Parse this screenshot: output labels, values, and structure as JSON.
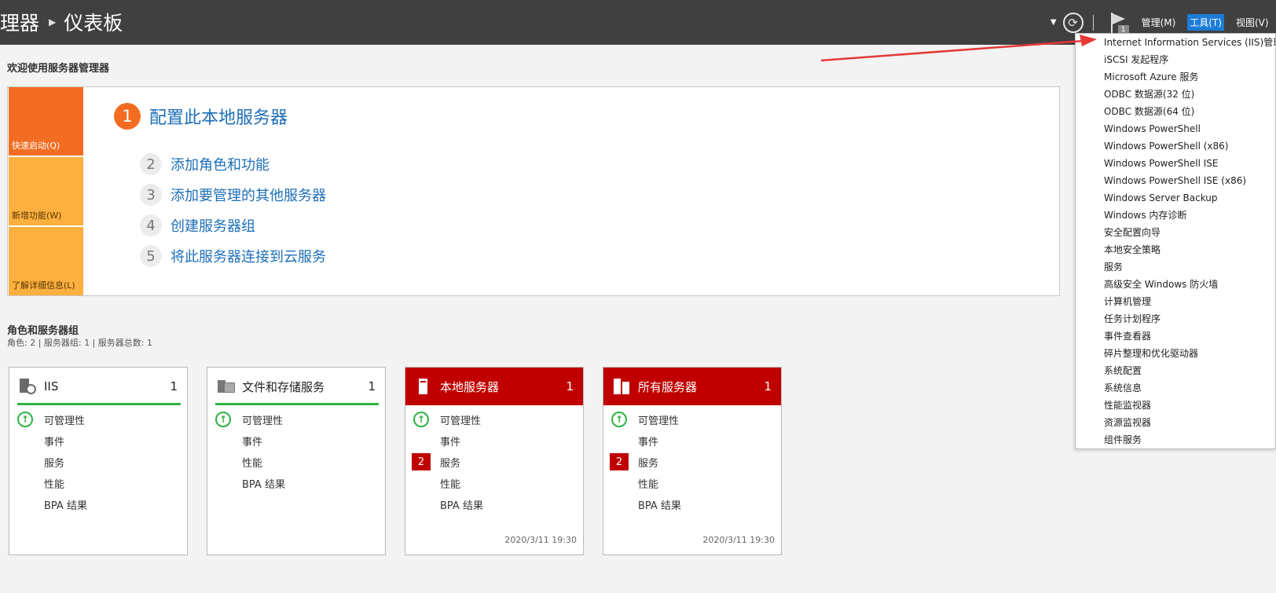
{
  "header": {
    "breadcrumb_parent": "理器",
    "breadcrumb_current": "仪表板",
    "flag_count": "1",
    "menu": {
      "manage": "管理(M)",
      "tools": "工具(T)",
      "view": "视图(V)"
    }
  },
  "welcome": {
    "title": "欢迎使用服务器管理器",
    "tiles": {
      "quick_start": "快速启动(Q)",
      "whats_new": "新增功能(W)",
      "learn_more": "了解详细信息(L)"
    },
    "steps": [
      {
        "num": "1",
        "label": "配置此本地服务器"
      },
      {
        "num": "2",
        "label": "添加角色和功能"
      },
      {
        "num": "3",
        "label": "添加要管理的其他服务器"
      },
      {
        "num": "4",
        "label": "创建服务器组"
      },
      {
        "num": "5",
        "label": "将此服务器连接到云服务"
      }
    ]
  },
  "roles": {
    "title": "角色和服务器组",
    "summary": "角色: 2 | 服务器组: 1 | 服务器总数: 1",
    "cards": [
      {
        "title": "IIS",
        "count": "1",
        "rows": [
          "可管理性",
          "事件",
          "服务",
          "性能",
          "BPA 结果"
        ]
      },
      {
        "title": "文件和存储服务",
        "count": "1",
        "rows": [
          "可管理性",
          "事件",
          "性能",
          "BPA 结果"
        ]
      },
      {
        "title": "本地服务器",
        "count": "1",
        "rows": [
          "可管理性",
          "事件",
          "服务",
          "性能",
          "BPA 结果"
        ],
        "service_badge": "2",
        "timestamp": "2020/3/11 19:30"
      },
      {
        "title": "所有服务器",
        "count": "1",
        "rows": [
          "可管理性",
          "事件",
          "服务",
          "性能",
          "BPA 结果"
        ],
        "service_badge": "2",
        "timestamp": "2020/3/11 19:30"
      }
    ]
  },
  "tools_menu": {
    "items": [
      "Internet Information Services (IIS)管理器",
      "iSCSI 发起程序",
      "Microsoft Azure 服务",
      "ODBC 数据源(32 位)",
      "ODBC 数据源(64 位)",
      "Windows PowerShell",
      "Windows PowerShell (x86)",
      "Windows PowerShell ISE",
      "Windows PowerShell ISE (x86)",
      "Windows Server Backup",
      "Windows 内存诊断",
      "安全配置向导",
      "本地安全策略",
      "服务",
      "高级安全 Windows 防火墙",
      "计算机管理",
      "任务计划程序",
      "事件查看器",
      "碎片整理和优化驱动器",
      "系统配置",
      "系统信息",
      "性能监视器",
      "资源监视器",
      "组件服务"
    ]
  },
  "colors": {
    "header_bg": "#404040",
    "accent_orange": "#f26d21",
    "tile_yellow": "#fbb040",
    "link_blue": "#1e6fb8",
    "alert_red": "#c00000",
    "ok_green": "#2fb344",
    "menu_active": "#1c7cd6",
    "annotation_arrow": "#e53935"
  }
}
